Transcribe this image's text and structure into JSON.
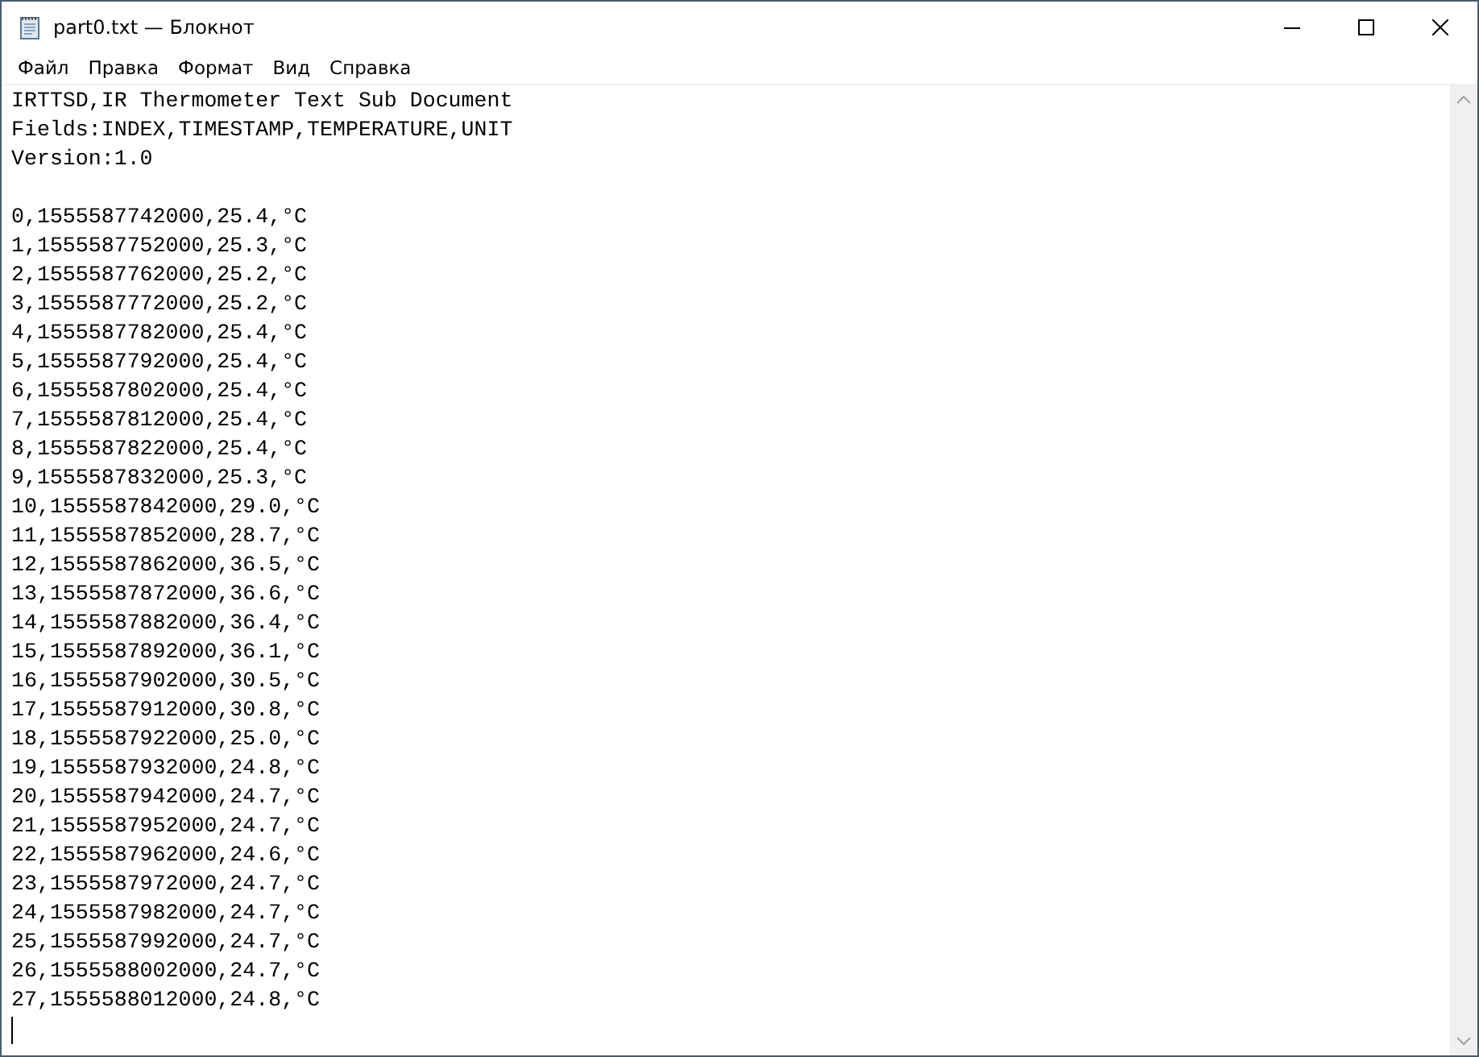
{
  "window": {
    "title": "part0.txt — Блокнот"
  },
  "menu": [
    "Файл",
    "Правка",
    "Формат",
    "Вид",
    "Справка"
  ],
  "document": {
    "header_lines": [
      "IRTTSD,IR Thermometer Text Sub Document",
      "Fields:INDEX,TIMESTAMP,TEMPERATURE,UNIT",
      "Version:1.0"
    ],
    "data_lines": [
      "0,1555587742000,25.4,°C",
      "1,1555587752000,25.3,°C",
      "2,1555587762000,25.2,°C",
      "3,1555587772000,25.2,°C",
      "4,1555587782000,25.4,°C",
      "5,1555587792000,25.4,°C",
      "6,1555587802000,25.4,°C",
      "7,1555587812000,25.4,°C",
      "8,1555587822000,25.4,°C",
      "9,1555587832000,25.3,°C",
      "10,1555587842000,29.0,°C",
      "11,1555587852000,28.7,°C",
      "12,1555587862000,36.5,°C",
      "13,1555587872000,36.6,°C",
      "14,1555587882000,36.4,°C",
      "15,1555587892000,36.1,°C",
      "16,1555587902000,30.5,°C",
      "17,1555587912000,30.8,°C",
      "18,1555587922000,25.0,°C",
      "19,1555587932000,24.8,°C",
      "20,1555587942000,24.7,°C",
      "21,1555587952000,24.7,°C",
      "22,1555587962000,24.6,°C",
      "23,1555587972000,24.7,°C",
      "24,1555587982000,24.7,°C",
      "25,1555587992000,24.7,°C",
      "26,1555588002000,24.7,°C",
      "27,1555588012000,24.8,°C"
    ]
  }
}
